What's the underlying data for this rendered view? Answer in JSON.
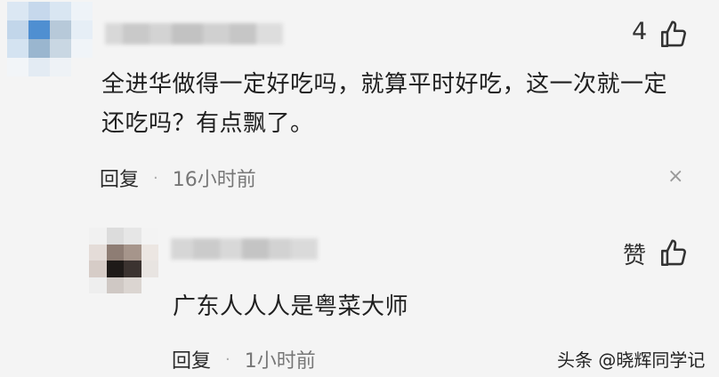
{
  "comment": {
    "like_count": "4",
    "text": "全进华做得一定好吃吗，就算平时好吃，这一次就一定还吃吗？有点飘了。",
    "reply_label": "回复",
    "separator": "·",
    "time": "16小时前",
    "close_glyph": "×"
  },
  "reply": {
    "like_label": "赞",
    "text": "广东人人人是粤菜大师",
    "reply_label": "回复",
    "separator": "·",
    "time": "1小时前"
  },
  "watermark": "头条 @晓辉同学记",
  "colors": {
    "background": "#f4f4f4",
    "text": "#1f1f1f",
    "meta": "#777777"
  },
  "icons": {
    "like": "thumbs-up-icon",
    "close": "close-icon"
  }
}
